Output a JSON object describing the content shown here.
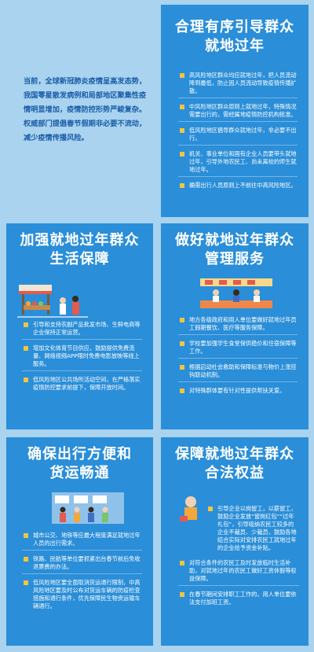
{
  "intro_text": "当前，全球新冠肺炎疫情呈高发态势，我国零星散发病例和局部地区聚集性疫情明显增加，疫情防控形势严峻复杂。权威部门提倡春节假期非必要不流动，减少疫情传播风险。",
  "cards": [
    {
      "title_line1": "合理有序引导群众",
      "title_line2": "就地过年",
      "items": [
        "高风险地区群众均应就地过年，把人员流动降到最低，防止因人员流动导致疫情传播扩散。",
        "中风险地区群众原则上就地过年，特殊情况需要出行的，需经属地疫情防控机构批准。",
        "低风险地区倡导群众就地过年，非必要不出行。",
        "机关、事业单位和国有企业人员要带头就地过年，引导外地农民工、尚未离校的师生就地过年。",
        "确需出行人员原则上不前往中高风险地区。"
      ]
    },
    {
      "title_line1": "加强就地过年群众",
      "title_line2": "生活保障",
      "items": [
        "引导和支持农副产品批发市场、生鲜电商等企业保持正常运营。",
        "增加文化体育节目供应，鼓励提供免费流量、网络视频APP限时免费电影放映等线上服务。",
        "低风险地区公共场所活动空间，在严格落实疫情防控要求前提下，保障开放时间。"
      ]
    },
    {
      "title_line1": "做好就地过年群众",
      "title_line2": "管理服务",
      "items": [
        "地方各级政府和用人单位要做好就地过年员工假期餐饮、医疗等服务保障。",
        "学校要加强学生食堂保供稳价和住宿保障等工作。",
        "根据启动社会救助和保障标准与物价上涨挂钩联动机制。",
        "对特殊群体要有针对性提供帮扶关爱。"
      ]
    },
    {
      "title_line1": "确保出行方便和",
      "title_line2": "货运畅通",
      "items": [
        "城市公交、地铁等应最大程度满足就地过年人员的出行需求。",
        "铁路、民航等单位要抓紧出台春节前后免收退票费的办法。",
        "低风险地区要全面取消货运通行限制，中高风险地区要及时公布对货运车辆的防疫检查措施和通行条件，优先保障民生物资运输车辆通行。"
      ]
    },
    {
      "title_line1": "保障就地过年群众",
      "title_line2": "合法权益",
      "items": [
        "引导企业以岗留工，以薪留工，鼓励企业发放“留岗红包”“过年礼包”，引导吸纳农民工较多的企业不裁员、少裁员，鼓励各地结合实际对安排农民工就地过年的企业给予资金补贴。",
        "对符合条件的农民工及时发放临时生活补助，对就地过年的农民工做好工资休假等权益保障。",
        "在春节期间安排职工工作的，用人单位要依法支付加班工资。"
      ]
    }
  ]
}
